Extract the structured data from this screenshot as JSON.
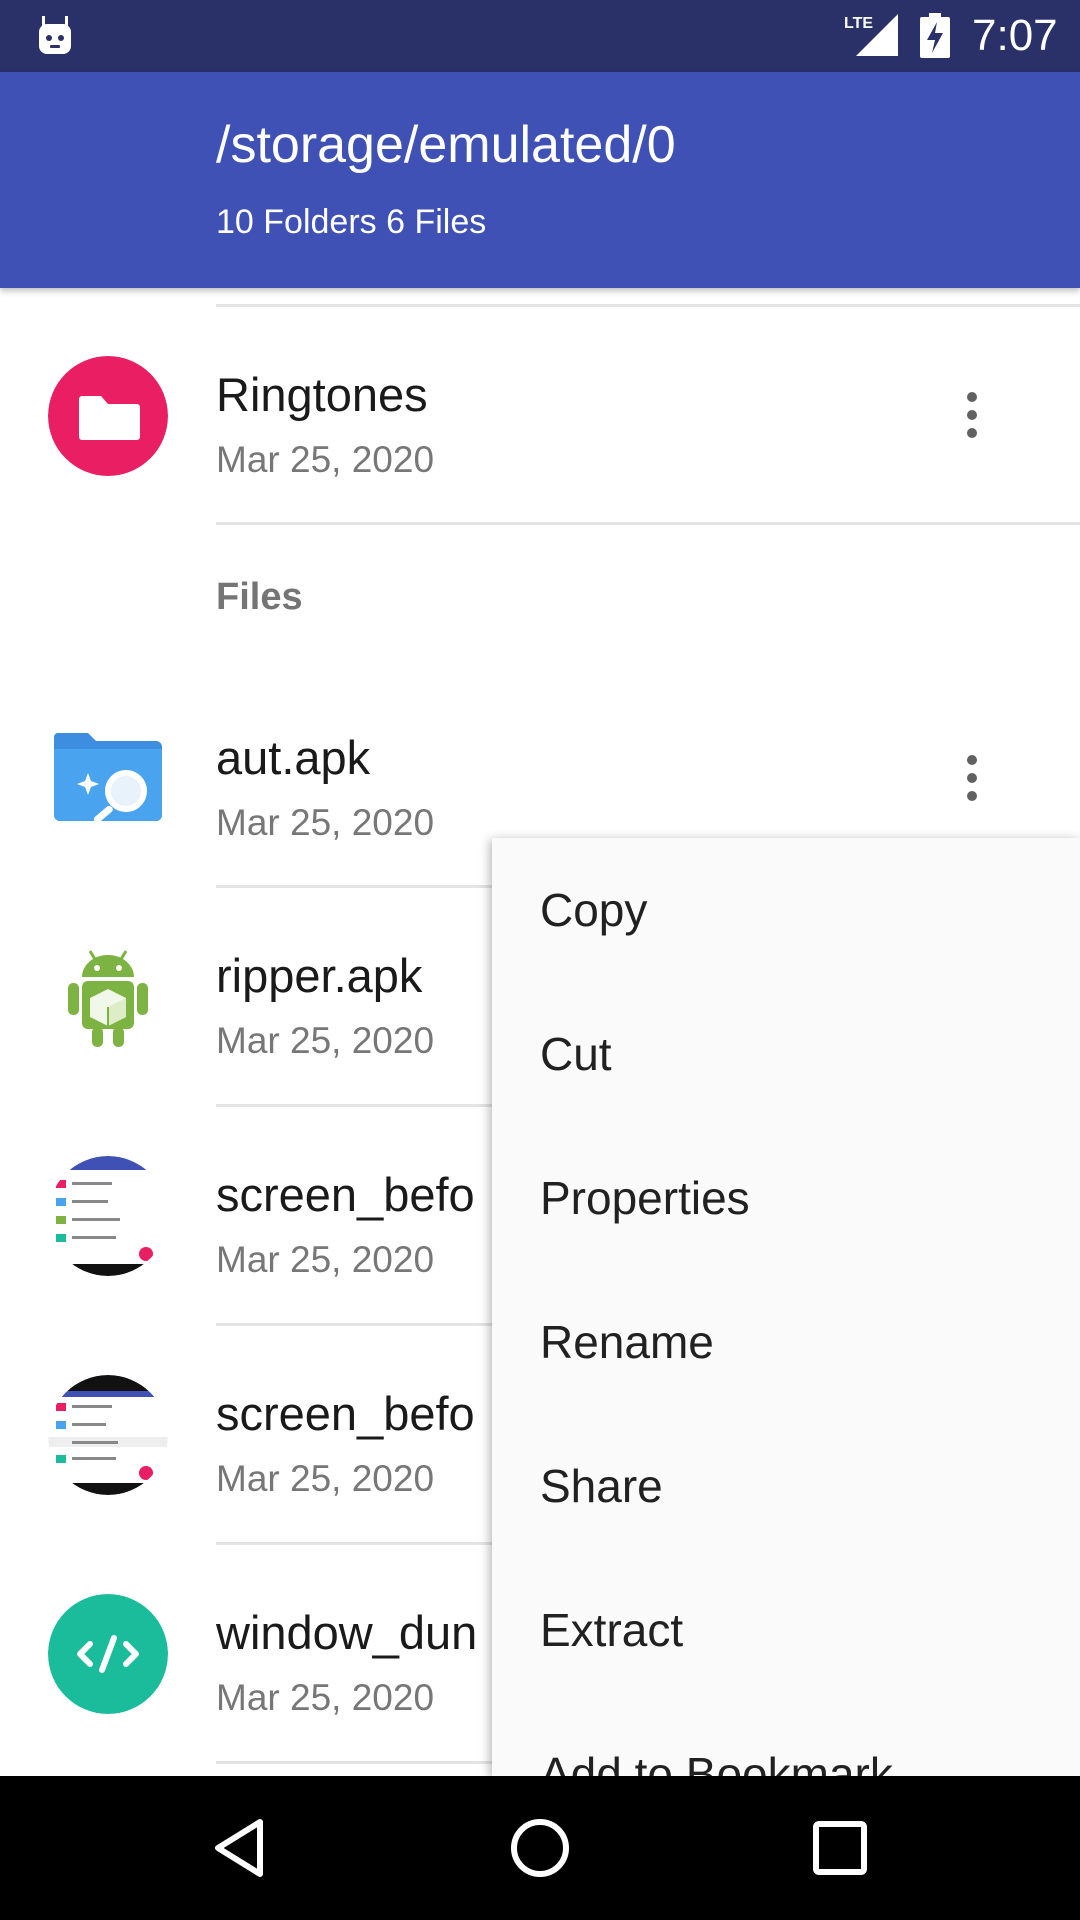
{
  "status_bar": {
    "time": "7:07",
    "network": "LTE",
    "icons": [
      "android-bot-icon",
      "lte-signal-icon",
      "battery-charging-icon"
    ]
  },
  "app_bar": {
    "path": "/storage/emulated/0",
    "counts": "10 Folders 6 Files",
    "color": "#3f51b5"
  },
  "list": {
    "folder": {
      "name": "Ringtones",
      "date": "Mar 25, 2020",
      "icon": "folder-icon",
      "icon_color": "#e91e63"
    },
    "files_header": "Files",
    "files": [
      {
        "name": "aut.apk",
        "date": "Mar 25, 2020",
        "icon": "app-search-icon"
      },
      {
        "name": "ripper.apk",
        "date": "Mar 25, 2020",
        "icon": "android-apk-icon"
      },
      {
        "name": "screen_befo",
        "date": "Mar 25, 2020",
        "icon": "screenshot-thumbnail-icon"
      },
      {
        "name": "screen_befo",
        "date": "Mar 25, 2020",
        "icon": "screenshot-thumbnail-icon"
      },
      {
        "name": "window_dun",
        "date": "Mar 25, 2020",
        "icon": "code-file-icon",
        "icon_color": "#1abc9c"
      }
    ]
  },
  "context_menu": {
    "items": [
      "Copy",
      "Cut",
      "Properties",
      "Rename",
      "Share",
      "Extract",
      "Add to Bookmark"
    ]
  },
  "nav_bar": {
    "buttons": [
      "back-icon",
      "home-icon",
      "recents-icon"
    ]
  }
}
